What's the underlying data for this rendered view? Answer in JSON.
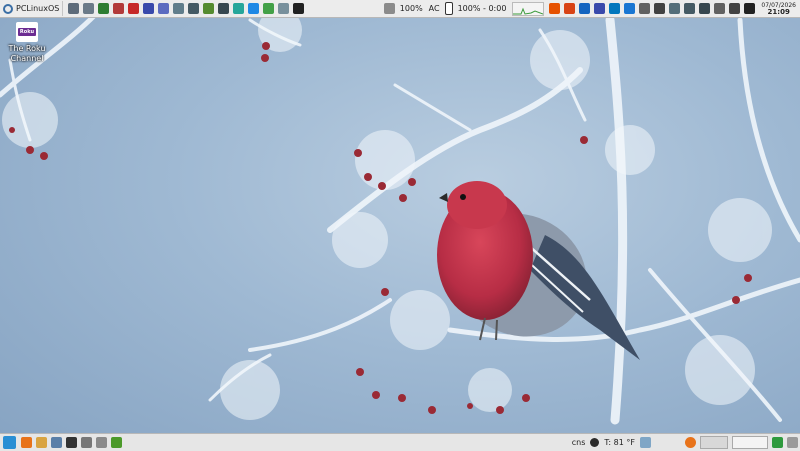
{
  "top_panel": {
    "menu_label": "PCLinuxOS",
    "launchers": [
      {
        "name": "control-center-icon",
        "color": "#5d6b7a"
      },
      {
        "name": "file-manager-icon",
        "color": "#6a7a88"
      },
      {
        "name": "text-editor-icon",
        "color": "#2e7d32"
      },
      {
        "name": "graphics-icon",
        "color": "#b23a3a"
      },
      {
        "name": "media-player-icon",
        "color": "#c62828"
      },
      {
        "name": "browser-icon",
        "color": "#3949ab"
      },
      {
        "name": "update-icon",
        "color": "#5c6bc0"
      },
      {
        "name": "notes-icon",
        "color": "#607d8b"
      },
      {
        "name": "calculator-icon",
        "color": "#455a64"
      },
      {
        "name": "search-icon",
        "color": "#558b2f"
      },
      {
        "name": "monitor-icon",
        "color": "#37474f"
      },
      {
        "name": "chat-icon",
        "color": "#26a69a"
      },
      {
        "name": "document-icon",
        "color": "#1e88e5"
      },
      {
        "name": "spreadsheet-icon",
        "color": "#43a047"
      },
      {
        "name": "presentation-icon",
        "color": "#78909c"
      },
      {
        "name": "video-icon",
        "color": "#212121"
      }
    ],
    "cpu_label": "100%",
    "ac_label": "AC",
    "battery_label": "100% - 0:00",
    "tray_icons": [
      {
        "name": "firefox-icon",
        "color": "#e65100"
      },
      {
        "name": "shield-icon",
        "color": "#d84315"
      },
      {
        "name": "dropbox-icon",
        "color": "#1565c0"
      },
      {
        "name": "vpn-icon",
        "color": "#3949ab"
      },
      {
        "name": "network-icon",
        "color": "#0277bd"
      },
      {
        "name": "bluetooth-icon",
        "color": "#1976d2"
      },
      {
        "name": "mic-icon",
        "color": "#616161"
      },
      {
        "name": "headset-icon",
        "color": "#424242"
      },
      {
        "name": "printer-icon",
        "color": "#546e7a"
      },
      {
        "name": "camera-icon",
        "color": "#455a64"
      },
      {
        "name": "usb-icon",
        "color": "#37474f"
      },
      {
        "name": "clipboard-icon",
        "color": "#616161"
      },
      {
        "name": "battery-icon",
        "color": "#424242"
      },
      {
        "name": "volume-icon",
        "color": "#212121"
      }
    ],
    "clock": {
      "date": "07/07/2026",
      "time": "21:09"
    }
  },
  "desktop": {
    "icon_badge": "Roku",
    "icon_label_line1": "The Roku",
    "icon_label_line2": "Channel"
  },
  "bottom_panel": {
    "tasks": [
      {
        "name": "firefox-icon",
        "color": "#e8731a"
      },
      {
        "name": "files-icon",
        "color": "#d9a441"
      },
      {
        "name": "editor-icon",
        "color": "#5a7fa8"
      },
      {
        "name": "terminal-icon",
        "color": "#333333"
      },
      {
        "name": "settings-icon",
        "color": "#777777"
      },
      {
        "name": "mail-icon",
        "color": "#8a8a8a"
      },
      {
        "name": "synaptic-icon",
        "color": "#4c9a2a"
      }
    ],
    "cns_label": "cns",
    "temp_label": "T: 81 °F",
    "end_icon_color": "#2e9a3e"
  }
}
